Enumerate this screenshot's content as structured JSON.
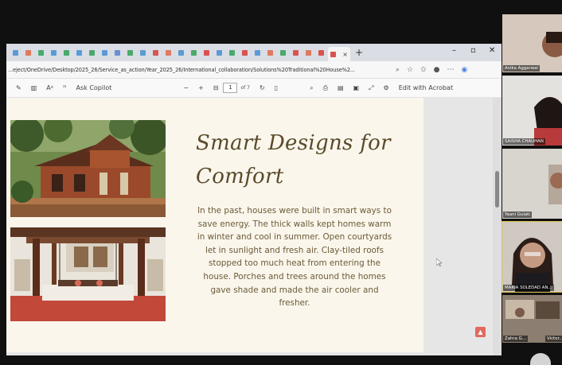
{
  "browser": {
    "url": "...eject/OneDrive/Desktop/2025_26/Service_as_action/Year_2025_26/International_collaboration/Solutions%20Traditional%20House%2...",
    "tab_close": "×",
    "new_tab": "+",
    "win_min": "–",
    "win_max": "▫",
    "win_close": "✕",
    "tab_colors": [
      "#5b9bd5",
      "#e07a5f",
      "#4aa96c",
      "#5b9bd5",
      "#4aa96c",
      "#5b9bd5",
      "#4aa96c",
      "#5b9bd5",
      "#6a8fd8",
      "#4aa96c",
      "#5b9bd5",
      "#d9534f",
      "#e07a5f",
      "#5b9bd5",
      "#4aa96c",
      "#d9534f",
      "#5b9bd5",
      "#4aa96c",
      "#d9534f",
      "#5b9bd5",
      "#e07a5f",
      "#4aa96c",
      "#d9534f",
      "#e07a5f",
      "#d9534f"
    ]
  },
  "pdf_toolbar": {
    "copilot_label": "Ask Copilot",
    "zoom_out": "−",
    "zoom_in": "+",
    "page_current": "1",
    "page_total": "of 7",
    "acrobat_label": "Edit with Acrobat",
    "read_aloud": "Aᵃ"
  },
  "pdf": {
    "title_line1": "Smart Designs for",
    "title_line2": "Comfort",
    "body": "In the past, houses were built in smart ways to save energy. The thick walls kept homes warm in winter and cool in summer. Open courtyards let in sunlight and fresh air. Clay-tiled roofs stopped too much heat from entering the house. Porches and trees around the homes gave shade and made the air cooler and fresher."
  },
  "participants": [
    {
      "name": "Anika Aggarwal"
    },
    {
      "name": "SAISHA CHAUHAN"
    },
    {
      "name": "Yaani Gulati"
    },
    {
      "name": "MARIA SOLEDAD AN..."
    },
    {
      "name": "Zahra G..."
    },
    {
      "name": "Victor..."
    }
  ],
  "colors": {
    "title": "#5a4a2a",
    "body": "#6c5a37",
    "page_bg": "#faf6ec"
  }
}
